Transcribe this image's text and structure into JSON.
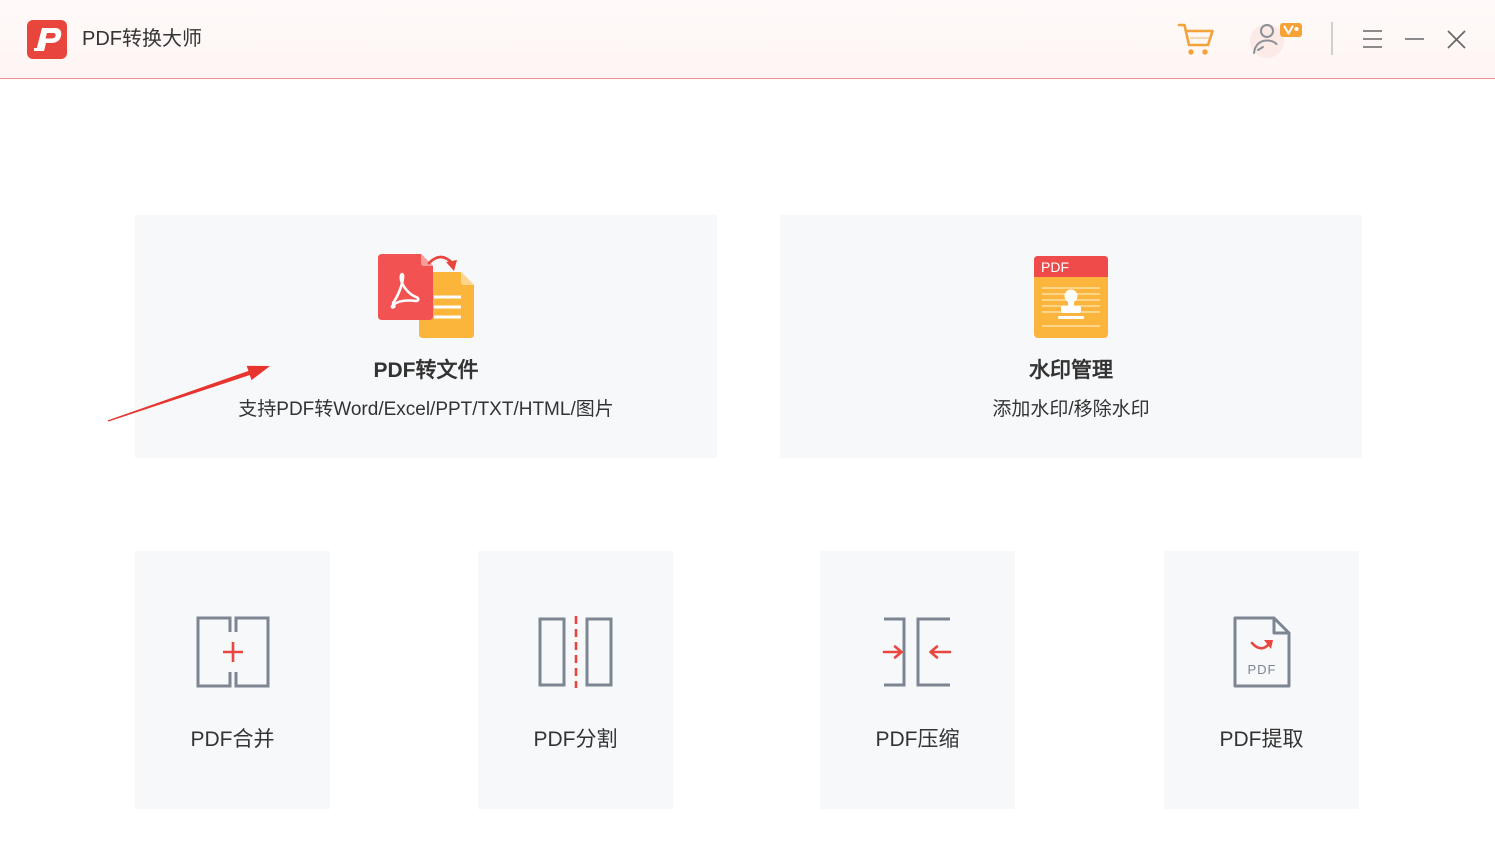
{
  "window": {
    "title": "PDF转换大师",
    "logo_icon": "pdf-master-logo-icon",
    "controls": {
      "cart": "cart-icon",
      "vip": "user-vip-icon",
      "menu": "menu-icon",
      "minimize": "minimize-icon",
      "close": "close-icon"
    }
  },
  "colors": {
    "brand_red": "#e8453c",
    "accent_orange": "#f4a33a",
    "card_background": "#f7f8fa",
    "icon_gray": "#7d8593",
    "titlebar_border": "#f0958d"
  },
  "main": {
    "feature_cards": [
      {
        "title": "PDF转文件",
        "subtitle": "支持PDF转Word/Excel/PPT/TXT/HTML/图片",
        "icon": "pdf-to-file-icon"
      },
      {
        "title": "水印管理",
        "subtitle": "添加水印/移除水印",
        "icon": "watermark-icon",
        "icon_label": "PDF"
      }
    ],
    "tool_cards": [
      {
        "label": "PDF合并",
        "icon": "merge-icon"
      },
      {
        "label": "PDF分割",
        "icon": "split-icon"
      },
      {
        "label": "PDF压缩",
        "icon": "compress-icon"
      },
      {
        "label": "PDF提取",
        "icon": "extract-icon",
        "icon_label": "PDF"
      }
    ]
  },
  "annotation": {
    "icon": "red-arrow-annotation"
  }
}
